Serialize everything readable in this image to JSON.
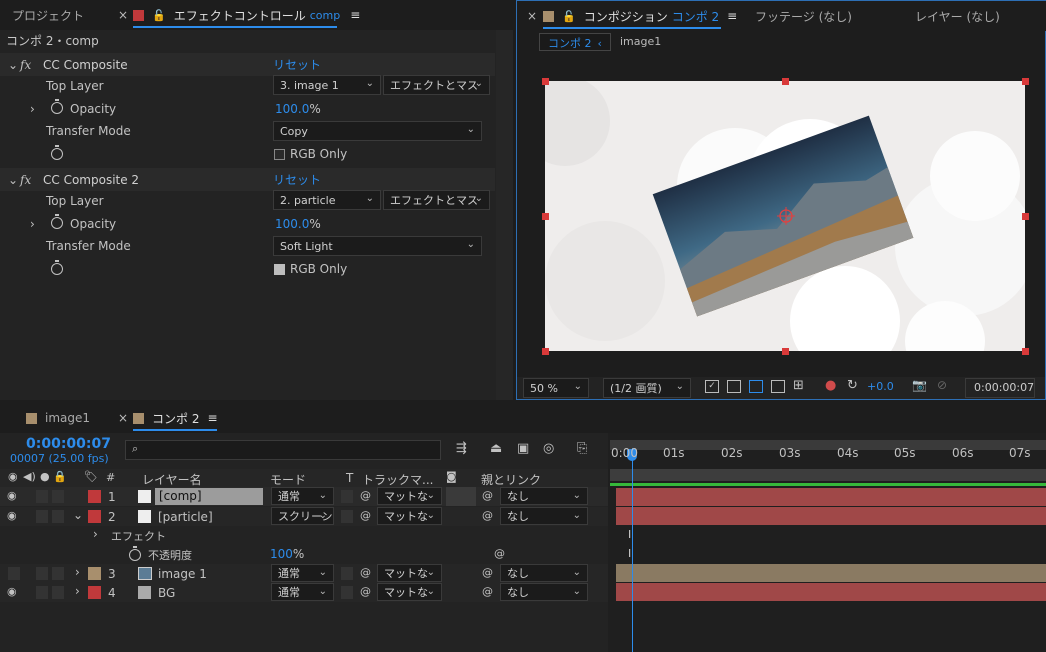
{
  "effect_panel": {
    "project_tab": "プロジェクト",
    "effect_tab_label": "エフェクトコントロール",
    "effect_tab_target": "comp",
    "breadcrumb": "コンポ 2・comp",
    "effects": [
      {
        "name": "CC Composite",
        "reset": "リセット",
        "top_layer_label": "Top Layer",
        "top_layer_value": "3. image 1",
        "top_layer_mode": "エフェクトとマス",
        "opacity_label": "Opacity",
        "opacity_value": "100.0",
        "opacity_unit": "%",
        "transfer_label": "Transfer Mode",
        "transfer_value": "Copy",
        "rgb_only_label": "RGB Only",
        "rgb_only_checked": false
      },
      {
        "name": "CC Composite 2",
        "reset": "リセット",
        "top_layer_label": "Top Layer",
        "top_layer_value": "2. particle",
        "top_layer_mode": "エフェクトとマス",
        "opacity_label": "Opacity",
        "opacity_value": "100.0",
        "opacity_unit": "%",
        "transfer_label": "Transfer Mode",
        "transfer_value": "Soft Light",
        "rgb_only_label": "RGB Only",
        "rgb_only_checked": true
      }
    ]
  },
  "comp_panel": {
    "tab_label": "コンポジション",
    "tab_target": "コンポ 2",
    "footage_tab": "フッテージ (なし)",
    "layer_tab": "レイヤー (なし)",
    "breadcrumb_active": "コンポ 2",
    "breadcrumb_next": "image1",
    "zoom": "50 %",
    "resolution": "(1/2 画質)",
    "exposure": "+0.0",
    "timecode": "0:00:00:07"
  },
  "timeline": {
    "tab1": "image1",
    "tab2": "コンポ 2",
    "timecode": "0:00:00:07",
    "frames": "00007 (25.00 fps)",
    "search_placeholder": "",
    "columns": {
      "name": "レイヤー名",
      "mode": "モード",
      "t": "T",
      "track": "トラックマ...",
      "parent": "親とリンク"
    },
    "ruler": [
      "0:00",
      "01s",
      "02s",
      "03s",
      "04s",
      "05s",
      "06s",
      "07s"
    ],
    "layers": [
      {
        "num": "1",
        "name": "[comp]",
        "mode": "通常",
        "track": "マットな",
        "parent": "なし",
        "color": "#c0393b"
      },
      {
        "num": "2",
        "name": "[particle]",
        "mode": "スクリーン",
        "track": "マットな",
        "parent": "なし",
        "color": "#c0393b"
      },
      {
        "num": "3",
        "name": "image 1",
        "mode": "通常",
        "track": "マットな",
        "parent": "なし",
        "color": "#a88f6d"
      },
      {
        "num": "4",
        "name": "BG",
        "mode": "通常",
        "track": "マットな",
        "parent": "なし",
        "color": "#c0393b"
      }
    ],
    "effects_label": "エフェクト",
    "opacity_label": "不透明度",
    "opacity_value": "100",
    "opacity_unit": "%"
  }
}
